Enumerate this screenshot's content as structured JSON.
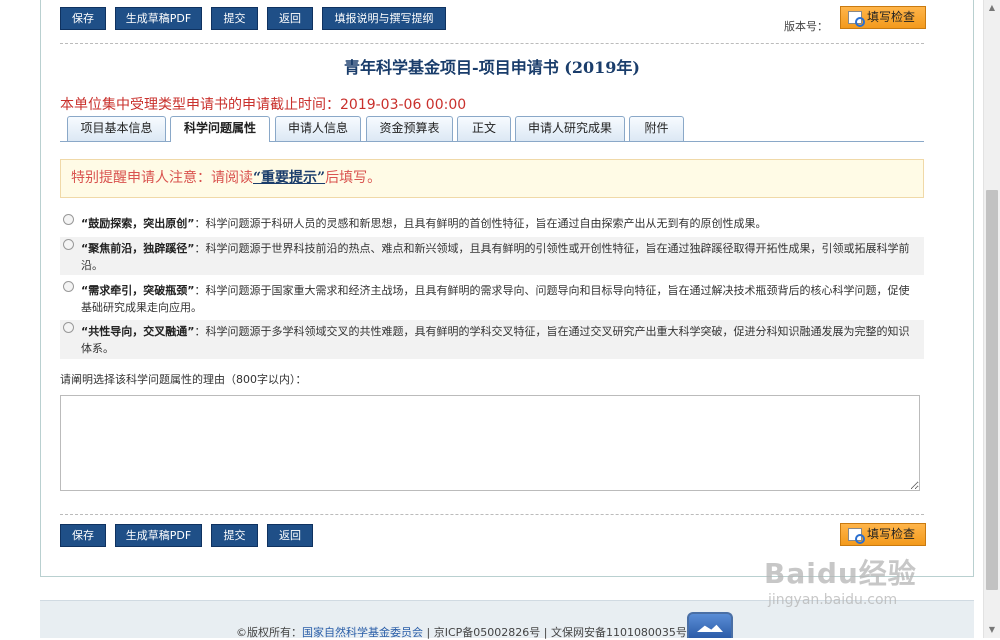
{
  "toolbar_top": {
    "save": "保存",
    "pdf": "生成草稿PDF",
    "submit": "提交",
    "back": "返回",
    "guide": "填报说明与撰写提纲",
    "version_label": "版本号：",
    "check": "填写检查"
  },
  "title": "青年科学基金项目-项目申请书 (2019年)",
  "deadline": {
    "label": "本单位集中受理类型申请书的申请截止时间：",
    "time": "2019-03-06 00:00"
  },
  "tabs": [
    {
      "label": "项目基本信息",
      "active": false
    },
    {
      "label": "科学问题属性",
      "active": true
    },
    {
      "label": "申请人信息",
      "active": false
    },
    {
      "label": "资金预算表",
      "active": false
    },
    {
      "label": "正文",
      "active": false
    },
    {
      "label": "申请人研究成果",
      "active": false
    },
    {
      "label": "附件",
      "active": false
    }
  ],
  "notice": {
    "prefix": "特别提醒申请人注意：请阅读",
    "link": "“重要提示”",
    "suffix": "后填写。"
  },
  "options": [
    {
      "title": "“鼓励探索，突出原创”",
      "desc": "：科学问题源于科研人员的灵感和新思想，且具有鲜明的首创性特征，旨在通过自由探索产出从无到有的原创性成果。"
    },
    {
      "title": "“聚焦前沿，独辟蹊径”",
      "desc": "：科学问题源于世界科技前沿的热点、难点和新兴领域，且具有鲜明的引领性或开创性特征，旨在通过独辟蹊径取得开拓性成果，引领或拓展科学前沿。"
    },
    {
      "title": "“需求牵引，突破瓶颈”",
      "desc": "：科学问题源于国家重大需求和经济主战场，且具有鲜明的需求导向、问题导向和目标导向特征，旨在通过解决技术瓶颈背后的核心科学问题，促使基础研究成果走向应用。"
    },
    {
      "title": "“共性导向，交叉融通”",
      "desc": "：科学问题源于多学科领域交叉的共性难题，具有鲜明的学科交叉特征，旨在通过交叉研究产出重大科学突破，促进分科知识融通发展为完整的知识体系。"
    }
  ],
  "reason_label": "请阐明选择该科学问题属性的理由（800字以内）：",
  "reason_value": "",
  "toolbar_bottom": {
    "save": "保存",
    "pdf": "生成草稿PDF",
    "submit": "提交",
    "back": "返回",
    "check": "填写检查"
  },
  "footer": {
    "copyright": "©版权所有：",
    "org": "国家自然科学基金委员会",
    "icp": " | 京ICP备05002826号 | 文保网安备1101080035号"
  },
  "watermark": {
    "brand": "Baidu经验",
    "url": "jingyan.baidu.com"
  }
}
